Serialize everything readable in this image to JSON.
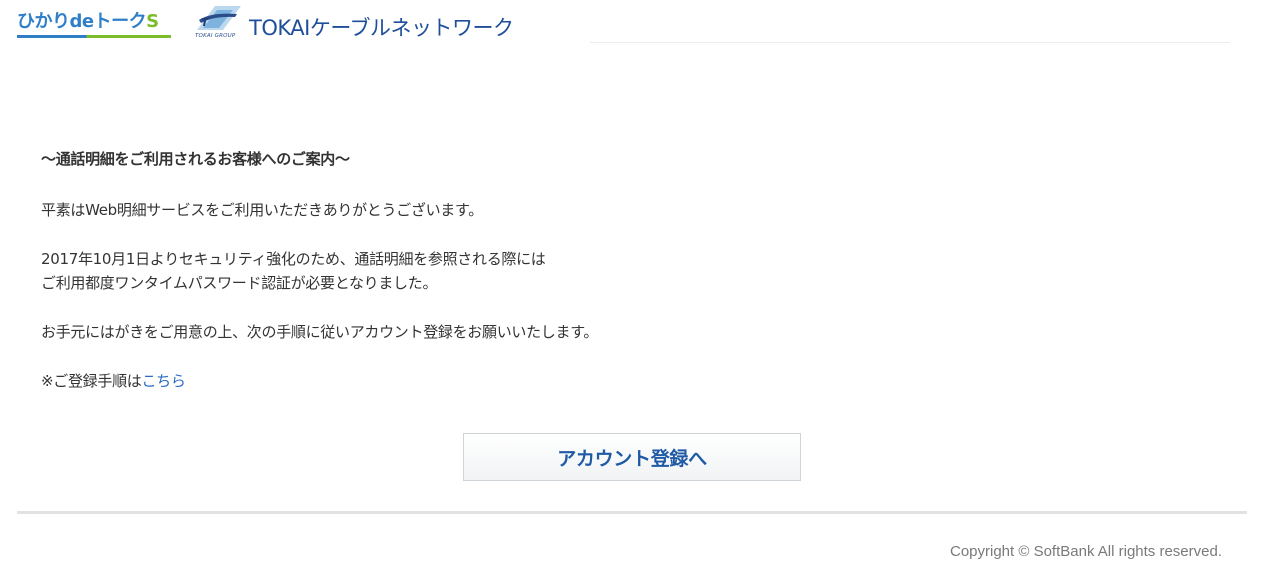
{
  "header": {
    "service_logo": {
      "word": "ひかりdeトーク",
      "suffix": "S"
    },
    "company_logo": {
      "group_text": "TOKAI GROUP",
      "name": "TOKAIケーブルネットワーク"
    }
  },
  "main": {
    "heading": "～通話明細をご利用されるお客様へのご案内～",
    "greeting": "平素はWeb明細サービスをご利用いただきありがとうございます。",
    "notice_line1": "2017年10月1日よりセキュリティ強化のため、通話明細を参照される際には",
    "notice_line2": "ご利用都度ワンタイムパスワード認証が必要となりました。",
    "instruction": "お手元にはがきをご用意の上、次の手順に従いアカウント登録をお願いいたします。",
    "procedure_prefix": "※ご登録手順は",
    "procedure_link": "こちら",
    "register_button": "アカウント登録へ"
  },
  "footer": {
    "copyright": "Copyright © SoftBank All rights reserved."
  },
  "colors": {
    "link": "#2a6cc4",
    "button_text": "#1f5aa6",
    "brand_blue": "#2f7fc8",
    "brand_green": "#7bbd2a",
    "tokai_navy": "#1f4f9a"
  }
}
